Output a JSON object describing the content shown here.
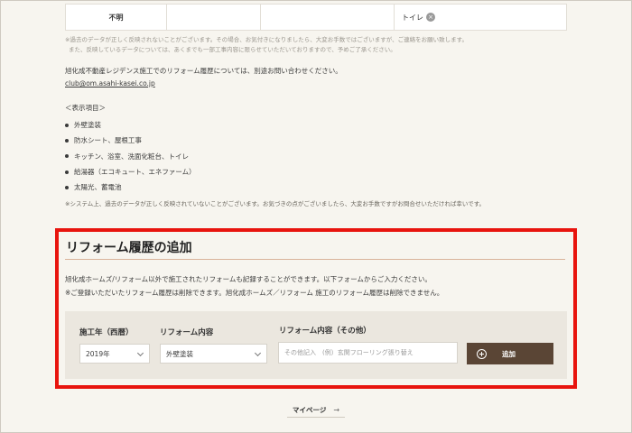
{
  "history_table": {
    "row": {
      "year": "不明",
      "col2": "",
      "col3": "",
      "item_tag": "トイレ",
      "tag_remove": "×"
    }
  },
  "notes": {
    "data_note_1": "※過去のデータが正しく反映されないことがございます。その場合、お気付きになりましたら、大変お手数ではございますが、ご連絡をお願い致します。",
    "data_note_2": "また、反映しているデータについては、あくまでも一部工事内容に限らせていただいておりますので、予めご了承ください。",
    "inquiry_text": "旭化成不動産レジデンス施工でのリフォーム履歴については、別途お問い合わせください。",
    "email": "club@om.asahi-kasei.co.jp",
    "display_items_heading": "＜表示項目＞",
    "display_items": [
      "外壁塗装",
      "防水シート、屋根工事",
      "キッチン、浴室、洗面化粧台、トイレ",
      "給湯器（エコキュート、エネファーム）",
      "太陽光、蓄電池"
    ],
    "system_note": "※システム上、過去のデータが正しく反映されていないことがございます。お気づきの点がございましたら、大変お手数ですがお問合せいただければ幸いです。"
  },
  "add_section": {
    "title": "リフォーム履歴の追加",
    "desc_1": "旭化成ホームズ/リフォーム以外で施工されたリフォームも記録することができます。以下フォームからご入力ください。",
    "desc_2": "※ご登録いただいたリフォーム履歴は削除できます。旭化成ホームズ／リフォーム 施工のリフォーム履歴は削除できません。",
    "year_label": "施工年（西暦）",
    "year_value": "2019年",
    "content_label": "リフォーム内容",
    "content_value": "外壁塗装",
    "other_label": "リフォーム内容（その他）",
    "other_placeholder": "その他記入　(例）玄関フローリング張り替え",
    "add_button": "追加"
  },
  "footer": {
    "mypage_link": "マイページ",
    "arrow": "→"
  },
  "colors": {
    "accent_red": "#e8140e",
    "button_brown": "#5a4535",
    "background": "#f7f5ef"
  }
}
